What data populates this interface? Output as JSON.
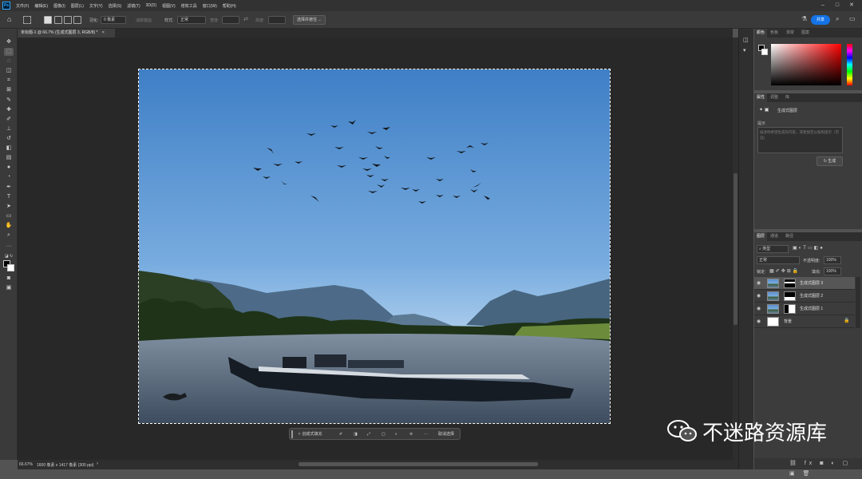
{
  "menubar": {
    "logo": "Ps",
    "items": [
      "文件(F)",
      "编辑(E)",
      "图像(I)",
      "图层(L)",
      "文字(Y)",
      "选择(S)",
      "滤镜(T)",
      "3D(D)",
      "视图(V)",
      "增效工具",
      "窗口(W)",
      "帮助(H)"
    ]
  },
  "options": {
    "feather_label": "羽化:",
    "feather_value": "0 像素",
    "antialias": "消除锯齿",
    "style_label": "样式:",
    "style_value": "正常",
    "width_label": "宽度:",
    "height_label": "高度:",
    "select_mask": "选择并遮住 ...",
    "share": "共享"
  },
  "tab": {
    "title": "未标题-1 @ 66.7% (生成式图层 3, RGB/8) *",
    "close": "×"
  },
  "taskbar": {
    "generative_fill": "创成式填充",
    "deselect": "取消选择"
  },
  "status": {
    "zoom": "66.67%",
    "doc_size": "1600 像素 x 1417 像素 (300 ppi)",
    "arrow": "›"
  },
  "color_panel": {
    "tabs": [
      "颜色",
      "色板",
      "渐变",
      "图案"
    ]
  },
  "properties_panel": {
    "tabs": [
      "属性",
      "调整",
      "库"
    ],
    "layer_type": "生成式图层",
    "prompt_label": "提示",
    "prompt_placeholder": "描述你希望生成的内容，或者留空以按照提示（可选）",
    "generate_button": "生成"
  },
  "layers_panel": {
    "tabs": [
      "图层",
      "通道",
      "路径"
    ],
    "filter_kind": "类型",
    "blend_mode": "正常",
    "opacity_label": "不透明度:",
    "opacity_value": "100%",
    "lock_label": "锁定:",
    "fill_label": "填充:",
    "fill_value": "100%",
    "layers": [
      {
        "name": "生成式图层 3",
        "selected": true
      },
      {
        "name": "生成式图层 2",
        "selected": false
      },
      {
        "name": "生成式图层 1",
        "selected": false
      },
      {
        "name": "背景",
        "selected": false
      }
    ]
  },
  "watermark": {
    "text": "不迷路资源库"
  }
}
